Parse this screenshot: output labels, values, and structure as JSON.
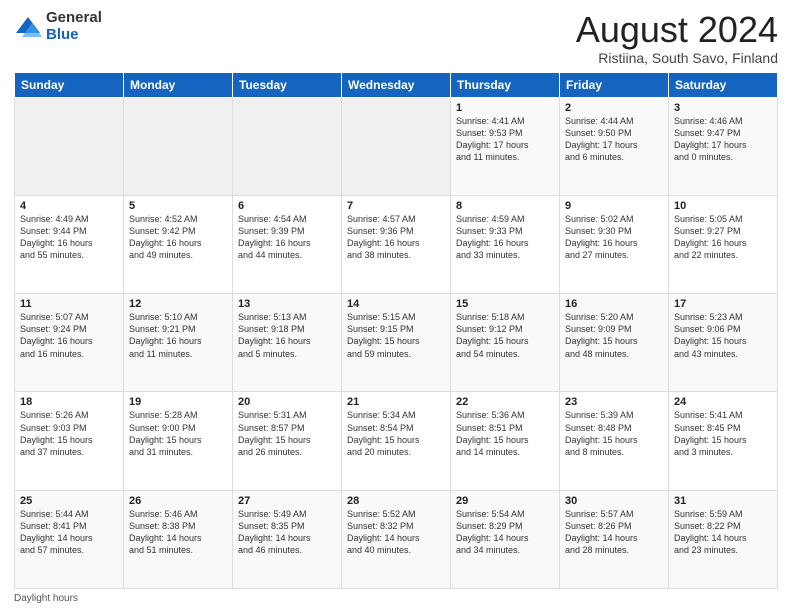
{
  "logo": {
    "general": "General",
    "blue": "Blue"
  },
  "header": {
    "title": "August 2024",
    "subtitle": "Ristiina, South Savo, Finland"
  },
  "weekdays": [
    "Sunday",
    "Monday",
    "Tuesday",
    "Wednesday",
    "Thursday",
    "Friday",
    "Saturday"
  ],
  "weeks": [
    [
      {
        "day": "",
        "content": ""
      },
      {
        "day": "",
        "content": ""
      },
      {
        "day": "",
        "content": ""
      },
      {
        "day": "",
        "content": ""
      },
      {
        "day": "1",
        "content": "Sunrise: 4:41 AM\nSunset: 9:53 PM\nDaylight: 17 hours\nand 11 minutes."
      },
      {
        "day": "2",
        "content": "Sunrise: 4:44 AM\nSunset: 9:50 PM\nDaylight: 17 hours\nand 6 minutes."
      },
      {
        "day": "3",
        "content": "Sunrise: 4:46 AM\nSunset: 9:47 PM\nDaylight: 17 hours\nand 0 minutes."
      }
    ],
    [
      {
        "day": "4",
        "content": "Sunrise: 4:49 AM\nSunset: 9:44 PM\nDaylight: 16 hours\nand 55 minutes."
      },
      {
        "day": "5",
        "content": "Sunrise: 4:52 AM\nSunset: 9:42 PM\nDaylight: 16 hours\nand 49 minutes."
      },
      {
        "day": "6",
        "content": "Sunrise: 4:54 AM\nSunset: 9:39 PM\nDaylight: 16 hours\nand 44 minutes."
      },
      {
        "day": "7",
        "content": "Sunrise: 4:57 AM\nSunset: 9:36 PM\nDaylight: 16 hours\nand 38 minutes."
      },
      {
        "day": "8",
        "content": "Sunrise: 4:59 AM\nSunset: 9:33 PM\nDaylight: 16 hours\nand 33 minutes."
      },
      {
        "day": "9",
        "content": "Sunrise: 5:02 AM\nSunset: 9:30 PM\nDaylight: 16 hours\nand 27 minutes."
      },
      {
        "day": "10",
        "content": "Sunrise: 5:05 AM\nSunset: 9:27 PM\nDaylight: 16 hours\nand 22 minutes."
      }
    ],
    [
      {
        "day": "11",
        "content": "Sunrise: 5:07 AM\nSunset: 9:24 PM\nDaylight: 16 hours\nand 16 minutes."
      },
      {
        "day": "12",
        "content": "Sunrise: 5:10 AM\nSunset: 9:21 PM\nDaylight: 16 hours\nand 11 minutes."
      },
      {
        "day": "13",
        "content": "Sunrise: 5:13 AM\nSunset: 9:18 PM\nDaylight: 16 hours\nand 5 minutes."
      },
      {
        "day": "14",
        "content": "Sunrise: 5:15 AM\nSunset: 9:15 PM\nDaylight: 15 hours\nand 59 minutes."
      },
      {
        "day": "15",
        "content": "Sunrise: 5:18 AM\nSunset: 9:12 PM\nDaylight: 15 hours\nand 54 minutes."
      },
      {
        "day": "16",
        "content": "Sunrise: 5:20 AM\nSunset: 9:09 PM\nDaylight: 15 hours\nand 48 minutes."
      },
      {
        "day": "17",
        "content": "Sunrise: 5:23 AM\nSunset: 9:06 PM\nDaylight: 15 hours\nand 43 minutes."
      }
    ],
    [
      {
        "day": "18",
        "content": "Sunrise: 5:26 AM\nSunset: 9:03 PM\nDaylight: 15 hours\nand 37 minutes."
      },
      {
        "day": "19",
        "content": "Sunrise: 5:28 AM\nSunset: 9:00 PM\nDaylight: 15 hours\nand 31 minutes."
      },
      {
        "day": "20",
        "content": "Sunrise: 5:31 AM\nSunset: 8:57 PM\nDaylight: 15 hours\nand 26 minutes."
      },
      {
        "day": "21",
        "content": "Sunrise: 5:34 AM\nSunset: 8:54 PM\nDaylight: 15 hours\nand 20 minutes."
      },
      {
        "day": "22",
        "content": "Sunrise: 5:36 AM\nSunset: 8:51 PM\nDaylight: 15 hours\nand 14 minutes."
      },
      {
        "day": "23",
        "content": "Sunrise: 5:39 AM\nSunset: 8:48 PM\nDaylight: 15 hours\nand 8 minutes."
      },
      {
        "day": "24",
        "content": "Sunrise: 5:41 AM\nSunset: 8:45 PM\nDaylight: 15 hours\nand 3 minutes."
      }
    ],
    [
      {
        "day": "25",
        "content": "Sunrise: 5:44 AM\nSunset: 8:41 PM\nDaylight: 14 hours\nand 57 minutes."
      },
      {
        "day": "26",
        "content": "Sunrise: 5:46 AM\nSunset: 8:38 PM\nDaylight: 14 hours\nand 51 minutes."
      },
      {
        "day": "27",
        "content": "Sunrise: 5:49 AM\nSunset: 8:35 PM\nDaylight: 14 hours\nand 46 minutes."
      },
      {
        "day": "28",
        "content": "Sunrise: 5:52 AM\nSunset: 8:32 PM\nDaylight: 14 hours\nand 40 minutes."
      },
      {
        "day": "29",
        "content": "Sunrise: 5:54 AM\nSunset: 8:29 PM\nDaylight: 14 hours\nand 34 minutes."
      },
      {
        "day": "30",
        "content": "Sunrise: 5:57 AM\nSunset: 8:26 PM\nDaylight: 14 hours\nand 28 minutes."
      },
      {
        "day": "31",
        "content": "Sunrise: 5:59 AM\nSunset: 8:22 PM\nDaylight: 14 hours\nand 23 minutes."
      }
    ]
  ],
  "footer": {
    "note": "Daylight hours"
  }
}
